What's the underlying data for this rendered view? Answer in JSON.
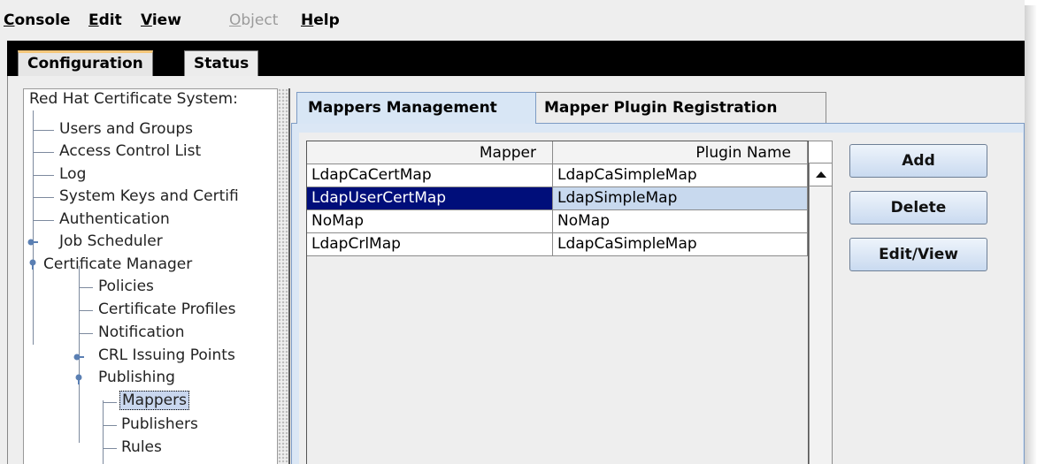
{
  "menubar": {
    "items": [
      {
        "label": "Console",
        "mnemonic": "C",
        "rest": "onsole",
        "enabled": true
      },
      {
        "label": "Edit",
        "mnemonic": "E",
        "rest": "dit",
        "enabled": true
      },
      {
        "label": "View",
        "mnemonic": "V",
        "rest": "iew",
        "enabled": true
      },
      {
        "label": "Object",
        "mnemonic": "O",
        "rest": "bject",
        "enabled": false
      },
      {
        "label": "Help",
        "mnemonic": "H",
        "rest": "elp",
        "enabled": true
      }
    ]
  },
  "top_tabs": {
    "configuration": "Configuration",
    "status": "Status",
    "active": "Configuration"
  },
  "tree": {
    "root": "Red Hat Certificate System:",
    "items": [
      "Users and Groups",
      "Access Control List",
      "Log",
      "System Keys and Certifi",
      "Authentication",
      "Job Scheduler",
      "Certificate Manager",
      "Policies",
      "Certificate Profiles",
      "Notification",
      "CRL Issuing Points",
      "Publishing",
      "Mappers",
      "Publishers",
      "Rules"
    ],
    "selected": "Mappers"
  },
  "right_tabs": {
    "mappers_management": "Mappers Management",
    "mapper_plugin_registration": "Mapper Plugin Registration",
    "active": "Mappers Management"
  },
  "table": {
    "columns": [
      "Mapper",
      "Plugin Name"
    ],
    "rows": [
      [
        "LdapCaCertMap",
        "LdapCaSimpleMap"
      ],
      [
        "LdapUserCertMap",
        "LdapSimpleMap"
      ],
      [
        "NoMap",
        "NoMap"
      ],
      [
        "LdapCrlMap",
        "LdapCaSimpleMap"
      ]
    ],
    "selected_row": "LdapUserCertMap"
  },
  "buttons": {
    "add": "Add",
    "delete": "Delete",
    "edit_view": "Edit/View"
  },
  "colors": {
    "selection_dark": "#000e7a",
    "selection_light": "#c8d9ee",
    "tab_panel": "#dbe7f5",
    "top_tab_highlight": "#f4c77a"
  }
}
